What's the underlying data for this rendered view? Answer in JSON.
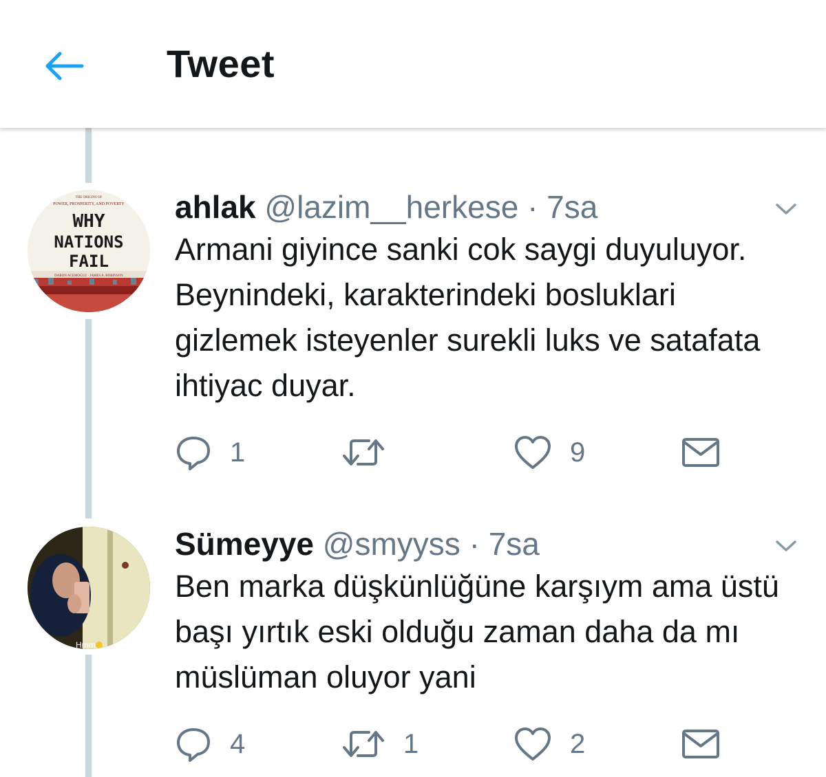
{
  "header": {
    "title": "Tweet",
    "back_icon": "arrow-left-icon",
    "accent_color": "#1da1f2"
  },
  "tweets": [
    {
      "display_name": "ahlak",
      "handle": "@lazim__herkese",
      "separator": "·",
      "time": "7sa",
      "avatar": {
        "kind": "book-cover",
        "lines": [
          "THE ORIGINS OF",
          "POWER, PROSPERITY, AND POVERTY",
          "WHY",
          "NATIONS",
          "FAIL",
          "DARON ACEMOGLU · JAMES A. ROBINSON"
        ]
      },
      "text": "Armani giyince sanki cok saygi duyuluyor. Beynindeki, karakterindeki bosluklari gizlemek isteyenler surekli luks ve satafata ihtiyac duyar.",
      "reply_count": "1",
      "retweet_count": "",
      "like_count": "9"
    },
    {
      "display_name": "Sümeyye",
      "handle": "@smyyss",
      "separator": "·",
      "time": "7sa",
      "avatar": {
        "kind": "photo",
        "caption": "Hmm"
      },
      "text": "Ben marka düşkünlüğüne karşıym ama üstü başı yırtık eski olduğu zaman daha da mı müslüman oluyor yani",
      "reply_count": "4",
      "retweet_count": "1",
      "like_count": "2"
    }
  ],
  "icons": {
    "reply": "reply-icon",
    "retweet": "retweet-icon",
    "like": "heart-icon",
    "message": "envelope-icon",
    "more": "chevron-down-icon"
  },
  "colors": {
    "text": "#14171a",
    "muted": "#657786",
    "thread_line": "#ccd6dd"
  }
}
